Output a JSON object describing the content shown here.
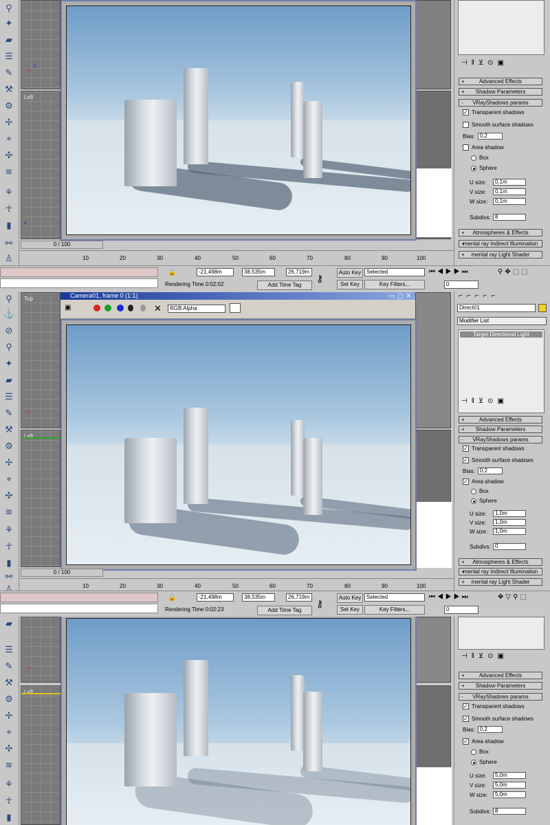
{
  "panels": [
    {
      "viewport_label": "Left",
      "rollouts": {
        "advanced": "Advanced Effects",
        "shadow_params": "Shadow Parameters",
        "vray": "VRayShadows params",
        "atmos": "Atmospheres & Effects",
        "mental_indirect": "mental ray Indirect Illumination",
        "mental_shader": "mental ray Light Shader"
      },
      "transparent_label": "Transparent shadows",
      "smooth_label": "Smooth surface shadows",
      "bias_label": "Bias:",
      "bias": "0,2",
      "area_label": "Area shadow",
      "box_label": "Box",
      "sphere_label": "Sphere",
      "u_label": "U size:",
      "u": "0,1m",
      "v_label": "V size:",
      "v": "0,1m",
      "w_label": "W size:",
      "w": "0,1m",
      "subdivs_label": "Subdivs:",
      "subdivs": "8",
      "frame": "0 / 100",
      "coords": {
        "x": "-21,498m",
        "y": "38,535m",
        "z": "26,719m"
      },
      "render_time": "Rendering Time  0:02:02",
      "add_time_tag": "Add Time Tag",
      "auto_key": "Auto Key",
      "set_key": "Set Key",
      "selected": "Selected",
      "key_filters": "Key Filters...",
      "frame_field": "0"
    },
    {
      "viewport_label": "Left",
      "top_label": "Top",
      "vfb_title": "Camera01, frame 0 (1:1)",
      "channel": "RGB Alpha",
      "object_name": "Direct01",
      "modifier_list": "Modifier List",
      "stack_item": "Target Directional Light",
      "rollouts": {
        "advanced": "Advanced Effects",
        "shadow_params": "Shadow Parameters",
        "vray": "VRayShadows params",
        "atmos": "Atmospheres & Effects",
        "mental_indirect": "mental ray Indirect Illumination",
        "mental_shader": "mental ray Light Shader"
      },
      "transparent_label": "Transparent shadows",
      "smooth_label": "Smooth surface shadows",
      "bias_label": "Bias:",
      "bias": "0,2",
      "area_label": "Area shadow",
      "box_label": "Box",
      "sphere_label": "Sphere",
      "u_label": "U size:",
      "u": "1,0m",
      "v_label": "V size:",
      "v": "1,0m",
      "w_label": "W size:",
      "w": "1,0m",
      "subdivs_label": "Subdivs:",
      "subdivs": "0",
      "frame": "0 / 100",
      "coords": {
        "x": "-21,498m",
        "y": "38,535m",
        "z": "26,719m"
      },
      "render_time": "Rendering Time  0:02:23",
      "add_time_tag": "Add Time Tag",
      "auto_key": "Auto Key",
      "set_key": "Set Key",
      "selected": "Selected",
      "key_filters": "Key Filters...",
      "frame_field": "0"
    },
    {
      "viewport_label": "Left",
      "rollouts": {
        "advanced": "Advanced Effects",
        "shadow_params": "Shadow Parameters",
        "vray": "VRayShadows params"
      },
      "transparent_label": "Transparent shadows",
      "smooth_label": "Smooth surface shadows",
      "bias_label": "Bias:",
      "bias": "0,2",
      "area_label": "Area shadow",
      "box_label": "Box",
      "sphere_label": "Sphere",
      "u_label": "U size:",
      "u": "5,0m",
      "v_label": "V size:",
      "v": "5,0m",
      "w_label": "W size:",
      "w": "5,0m",
      "subdivs_label": "Subdivs:",
      "subdivs": "8"
    }
  ],
  "timeline_ticks": [
    "10",
    "20",
    "30",
    "40",
    "50",
    "60",
    "70",
    "80",
    "90",
    "100"
  ]
}
